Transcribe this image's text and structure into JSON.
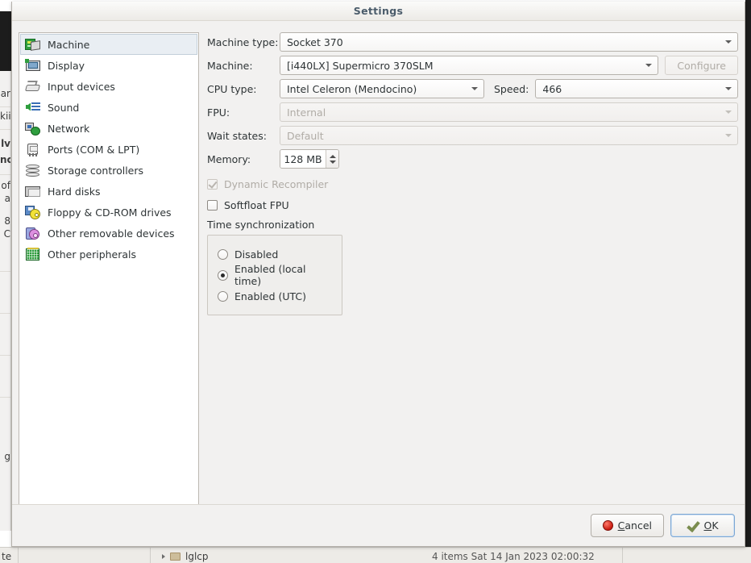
{
  "window": {
    "title": "Settings"
  },
  "sidebar": {
    "items": [
      {
        "label": "Machine",
        "icon": "machine-icon",
        "selected": true
      },
      {
        "label": "Display",
        "icon": "display-icon",
        "selected": false
      },
      {
        "label": "Input devices",
        "icon": "input-devices-icon",
        "selected": false
      },
      {
        "label": "Sound",
        "icon": "sound-icon",
        "selected": false
      },
      {
        "label": "Network",
        "icon": "network-icon",
        "selected": false
      },
      {
        "label": "Ports (COM & LPT)",
        "icon": "ports-icon",
        "selected": false
      },
      {
        "label": "Storage controllers",
        "icon": "storage-controllers-icon",
        "selected": false
      },
      {
        "label": "Hard disks",
        "icon": "hard-disks-icon",
        "selected": false
      },
      {
        "label": "Floppy & CD-ROM drives",
        "icon": "floppy-cdrom-icon",
        "selected": false
      },
      {
        "label": "Other removable devices",
        "icon": "removable-devices-icon",
        "selected": false
      },
      {
        "label": "Other peripherals",
        "icon": "other-peripherals-icon",
        "selected": false
      }
    ]
  },
  "form": {
    "machine_type": {
      "label": "Machine type:",
      "value": "Socket 370",
      "disabled": false
    },
    "machine": {
      "label": "Machine:",
      "value": "[i440LX] Supermicro 370SLM",
      "disabled": false
    },
    "configure": {
      "label": "Configure",
      "disabled": true
    },
    "cpu_type": {
      "label": "CPU type:",
      "value": "Intel Celeron (Mendocino)",
      "disabled": false
    },
    "speed": {
      "label": "Speed:",
      "value": "466",
      "disabled": false
    },
    "fpu": {
      "label": "FPU:",
      "value": "Internal",
      "disabled": true
    },
    "wait_states": {
      "label": "Wait states:",
      "value": "Default",
      "disabled": true
    },
    "memory": {
      "label": "Memory:",
      "value": "128 MB"
    },
    "dynamic_recompiler": {
      "label": "Dynamic Recompiler",
      "checked": true,
      "disabled": true
    },
    "softfloat_fpu": {
      "label": "Softfloat FPU",
      "checked": false,
      "disabled": false
    },
    "time_sync": {
      "title": "Time synchronization",
      "options": [
        {
          "label": "Disabled",
          "selected": false
        },
        {
          "label": "Enabled (local time)",
          "selected": true
        },
        {
          "label": "Enabled (UTC)",
          "selected": false
        }
      ]
    }
  },
  "footer": {
    "cancel": {
      "label": "Cancel",
      "accel": "C",
      "rest": "ancel",
      "icon": "stop-icon"
    },
    "ok": {
      "label": "OK",
      "accel": "O",
      "rest": "K",
      "icon": "check-icon",
      "focused": true
    }
  },
  "background": {
    "left_fragments": [
      "ar",
      "kii",
      "lv",
      "nc",
      "of",
      "a",
      "8",
      "C",
      "g"
    ],
    "statusbar": {
      "left_label": "te",
      "crumb": "lglcp",
      "status": "4 items    Sat 14 Jan 2023 02:00:32"
    }
  },
  "colors": {
    "window_bg": "#f2f1f0",
    "title_text": "#4b5c6b",
    "selection_bg": "#e9eef3",
    "selection_border": "#c3cfda",
    "focus_border": "#7ca7d4",
    "disabled_text": "#b0aca6",
    "cancel_icon": "#c91b10",
    "ok_icon": "#7a8c4e"
  }
}
